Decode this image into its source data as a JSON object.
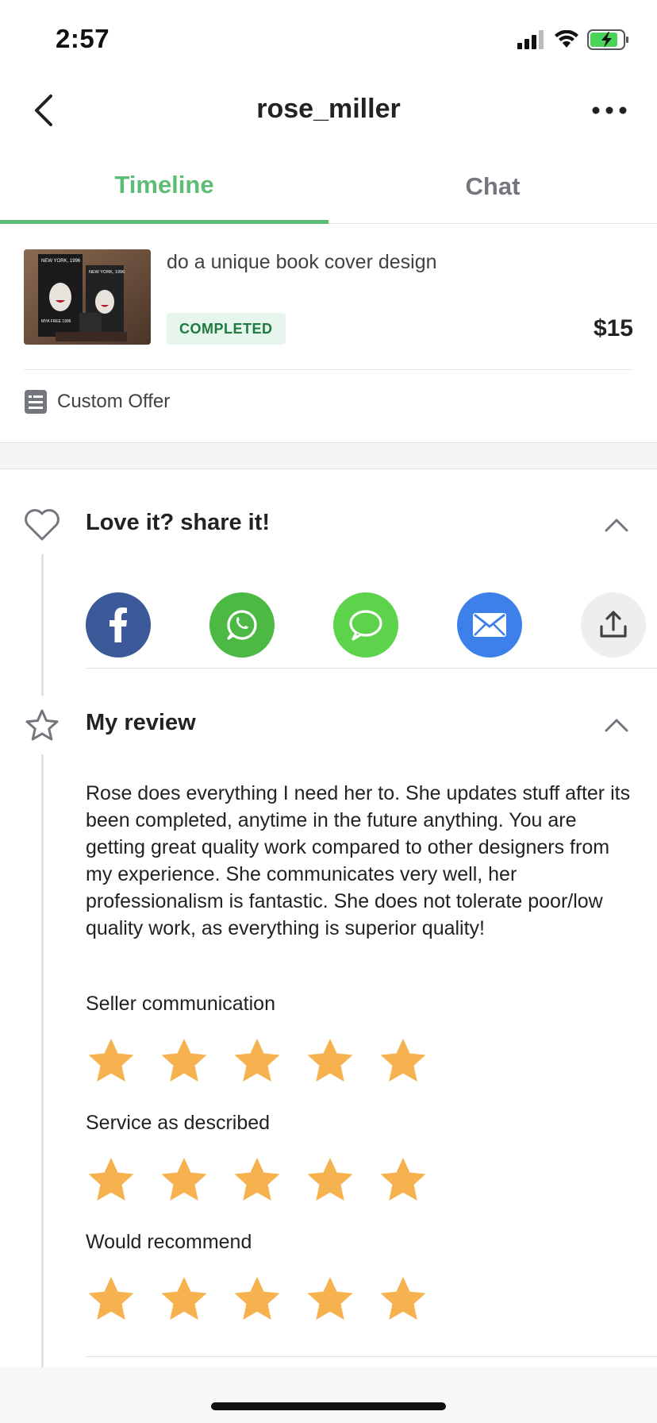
{
  "status_bar": {
    "time": "2:57"
  },
  "nav": {
    "title": "rose_miller"
  },
  "tabs": [
    {
      "label": "Timeline",
      "active": true
    },
    {
      "label": "Chat",
      "active": false
    }
  ],
  "order": {
    "title": "do a unique book cover design",
    "status": "COMPLETED",
    "price": "$15",
    "thumbnail_text": [
      "NEW YORK, 1996",
      "NEW YORK, 1996",
      "MYA FREE 1996"
    ]
  },
  "offer": {
    "label": "Custom Offer"
  },
  "share_section": {
    "title": "Love it? share it!",
    "buttons": [
      {
        "name": "facebook",
        "icon": "facebook-icon",
        "color": "#3b5998"
      },
      {
        "name": "whatsapp",
        "icon": "whatsapp-icon",
        "color": "#4cb944"
      },
      {
        "name": "messages",
        "icon": "message-bubble-icon",
        "color": "#5dd34c"
      },
      {
        "name": "email",
        "icon": "envelope-icon",
        "color": "#3d80ea"
      },
      {
        "name": "share",
        "icon": "share-upload-icon",
        "color": "#eeeeee"
      }
    ]
  },
  "review_section": {
    "title": "My review",
    "text": "Rose does everything I need her to. She updates stuff after its been completed, anytime in the future anything.  You are getting great quality work compared to other designers from my experience.  She communicates very well, her professionalism is fantastic. She does not tolerate poor/low quality work, as everything is superior quality!",
    "ratings": [
      {
        "label": "Seller communication",
        "stars": 5
      },
      {
        "label": "Service as described",
        "stars": 5
      },
      {
        "label": "Would recommend",
        "stars": 5
      }
    ]
  },
  "colors": {
    "accent": "#5ebd74",
    "star": "#f6b24f",
    "badge_bg": "#e6f6ec",
    "badge_text": "#1f7a3f"
  }
}
